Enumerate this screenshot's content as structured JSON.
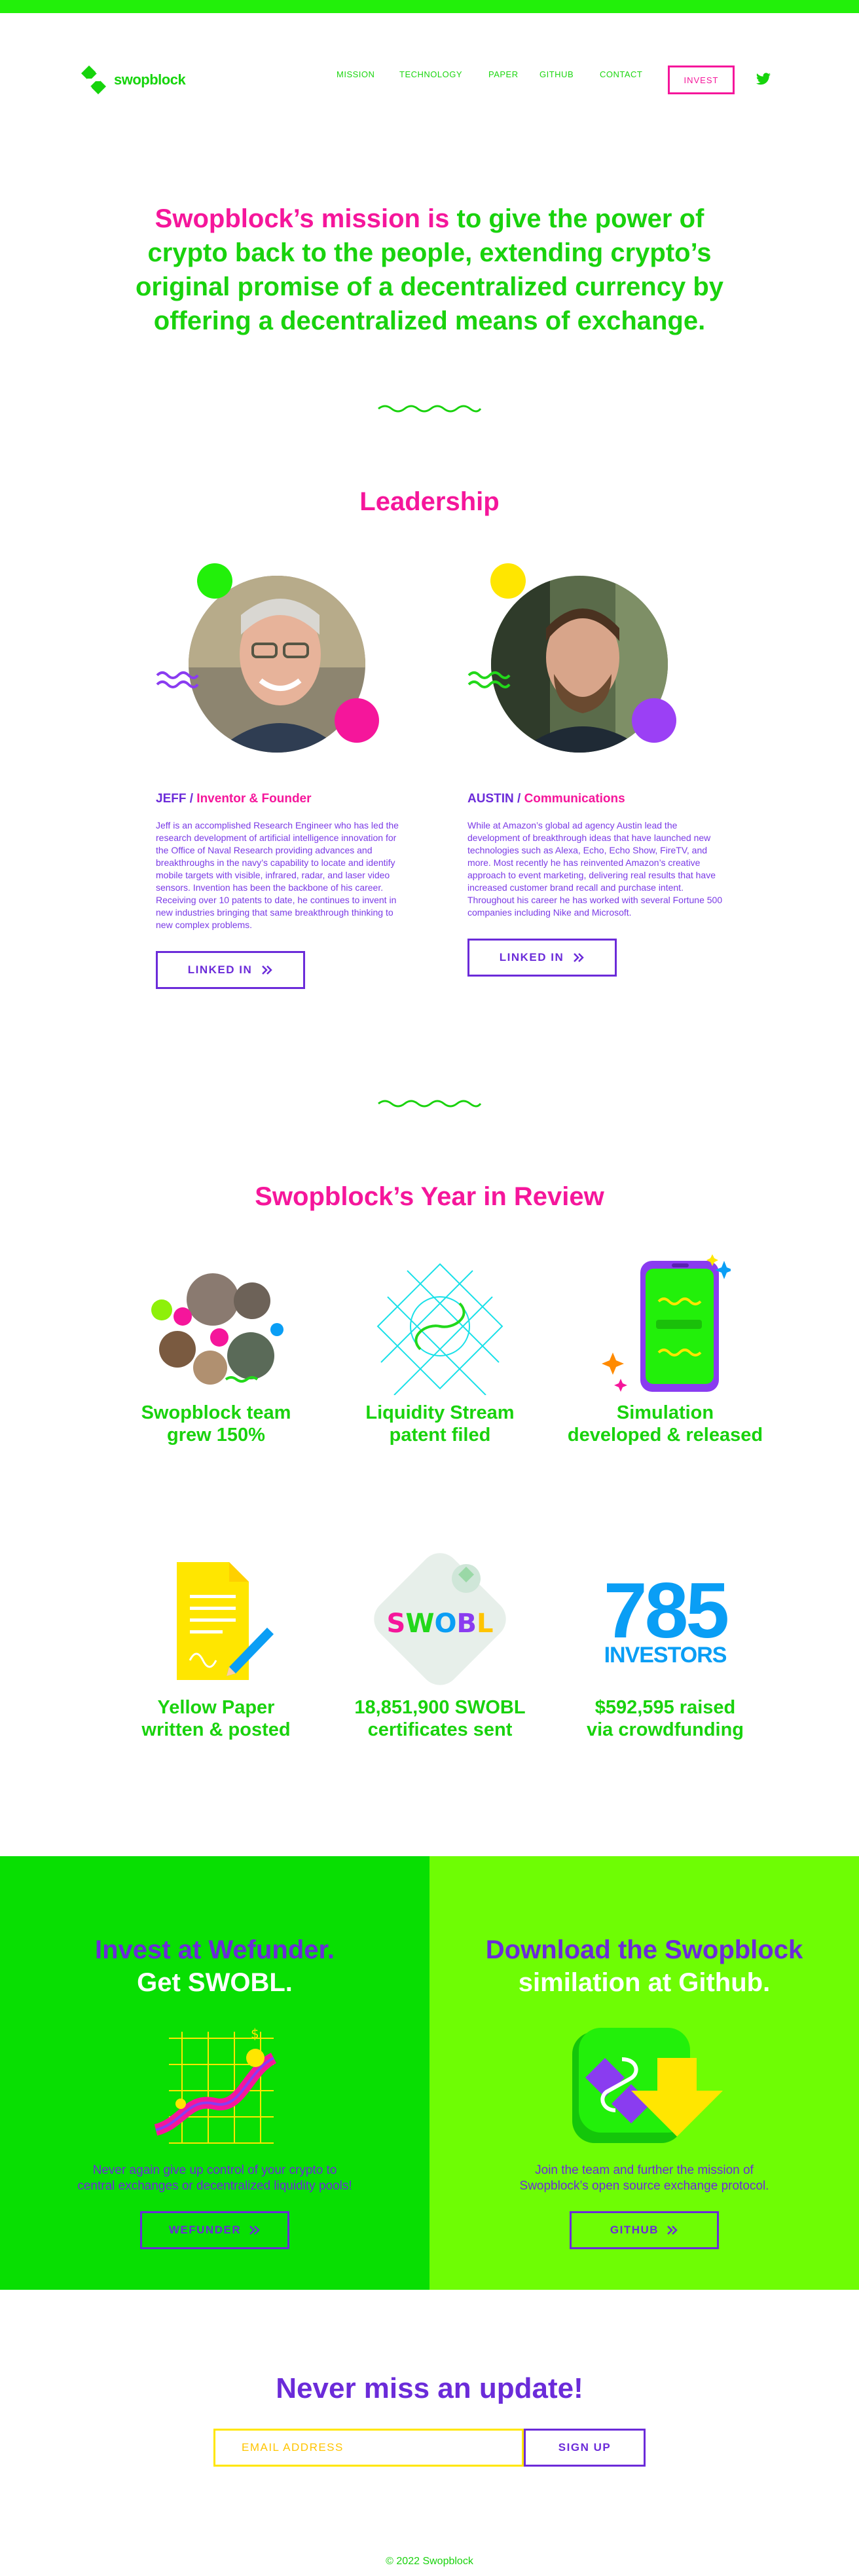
{
  "brand": {
    "name": "swopblock",
    "green": "#22f00a",
    "pink": "#f5169b",
    "purple": "#6b2bd9",
    "blue": "#0a9ef5"
  },
  "nav": {
    "links": [
      "MISSION",
      "TECHNOLOGY",
      "PAPER",
      "GITHUB",
      "CONTACT"
    ],
    "invest_label": "INVEST",
    "twitter_icon": "twitter-icon"
  },
  "mission": {
    "lead": "Swopblock’s mission is",
    "rest": " to give the power of crypto back to the people, extending crypto’s original promise of a decentralized currency by offering a decentralized means of exchange."
  },
  "leadership": {
    "title": "Leadership",
    "people": [
      {
        "name": "JEFF",
        "sep": " / ",
        "role": "Inventor & Founder",
        "bio": "Jeff is an accomplished Research Engineer who has led the research development of artificial intelligence innovation for the Office of Naval Research providing advances and breakthroughs in the navy’s capability to locate and identify mobile targets with visible, infrared, radar, and laser video sensors. Invention has been the backbone of his career. Receiving over 10 patents to date, he continues to invent in new industries bringing that same breakthrough thinking to new complex problems.",
        "button": "LINKED IN"
      },
      {
        "name": "AUSTIN",
        "sep": " / ",
        "role": "Communications",
        "bio": "While at Amazon’s global ad agency Austin lead the development of breakthrough ideas that have launched new technologies such as Alexa, Echo, Echo Show, FireTV, and more. Most recently he has reinvented Amazon’s creative approach to event marketing, delivering real results that have increased customer brand recall and purchase intent. Throughout his career he has worked with several Fortune 500 companies including Nike and Microsoft.",
        "button": "LINKED IN"
      }
    ]
  },
  "year_review": {
    "title": "Swopblock’s Year in Review",
    "items": [
      {
        "line1": "Swopblock team",
        "line2": "grew 150%"
      },
      {
        "line1": "Liquidity Stream",
        "line2": "patent filed"
      },
      {
        "line1": "Simulation",
        "line2": "developed & released"
      },
      {
        "line1": "Yellow Paper",
        "line2": "written & posted"
      },
      {
        "line1": "18,851,900 SWOBL",
        "line2": "certificates sent"
      },
      {
        "line1": "$592,595 raised",
        "line2": "via crowdfunding"
      }
    ],
    "investors_number": "785",
    "investors_label": "INVESTORS",
    "swobl_word": "SWOBL"
  },
  "cta": {
    "left": {
      "title1": "Invest at Wefunder.",
      "title2": "Get SWOBL.",
      "text1": "Never again give up control of your crypto to",
      "text2": "central exchanges or decentralized liquidity pools!",
      "button": "WEFUNDER"
    },
    "right": {
      "title1": "Download the Swopblock",
      "title2": "similation at Github.",
      "text1": "Join the team and further the mission of",
      "text2": "Swopblock’s open source exchange protocol.",
      "button": "GITHUB"
    }
  },
  "newsletter": {
    "title": "Never miss an update!",
    "placeholder": "EMAIL ADDRESS",
    "button": "SIGN UP"
  },
  "footer": {
    "copyright": "© 2022 Swopblock"
  }
}
